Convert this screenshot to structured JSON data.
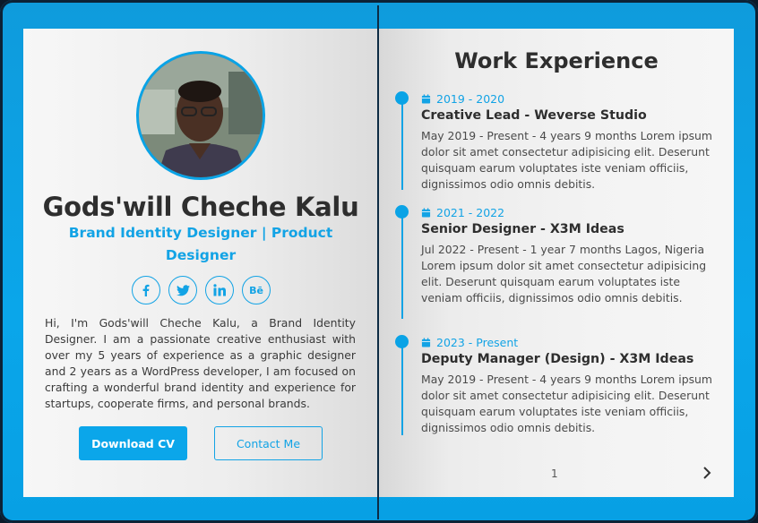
{
  "profile": {
    "name": "Gods'will Cheche Kalu",
    "role": "Brand Identity Designer | Product Designer",
    "bio": "Hi, I'm Gods'will Cheche Kalu, a Brand Identity Designer. I am a passionate creative enthusiast with over my 5 years of experience as a graphic designer and 2 years as a WordPress developer, I am focused on crafting a wonderful brand identity and experience for startups, cooperate firms, and personal brands.",
    "socials": [
      {
        "icon": "facebook-icon",
        "glyph": "f"
      },
      {
        "icon": "twitter-icon",
        "glyph": ""
      },
      {
        "icon": "linkedin-icon",
        "glyph": "in"
      },
      {
        "icon": "behance-icon",
        "glyph": "Bē"
      }
    ],
    "download_label": "Download CV",
    "contact_label": "Contact Me"
  },
  "experience": {
    "title": "Work Experience",
    "items": [
      {
        "dates": "2019 - 2020",
        "title": "Creative Lead - Weverse Studio",
        "desc": "May 2019 - Present - 4 years 9 months Lorem ipsum dolor sit amet consectetur adipisicing elit. Deserunt quisquam earum voluptates iste veniam officiis, dignissimos odio omnis debitis."
      },
      {
        "dates": "2021 - 2022",
        "title": "Senior Designer - X3M Ideas",
        "desc": "Jul 2022 - Present - 1 year 7 months Lagos, Nigeria Lorem ipsum dolor sit amet consectetur adipisicing elit. Deserunt quisquam earum voluptates iste veniam officiis, dignissimos odio omnis debitis."
      },
      {
        "dates": "2023 - Present",
        "title": "Deputy Manager (Design) - X3M Ideas",
        "desc": "May 2019 - Present - 4 years 9 months Lorem ipsum dolor sit amet consectetur adipisicing elit. Deserunt quisquam earum voluptates iste veniam officiis, dignissimos odio omnis debitis."
      }
    ]
  },
  "pagination": {
    "page": "1"
  },
  "colors": {
    "accent": "#0aa3e6",
    "text": "#2e2e2e"
  }
}
